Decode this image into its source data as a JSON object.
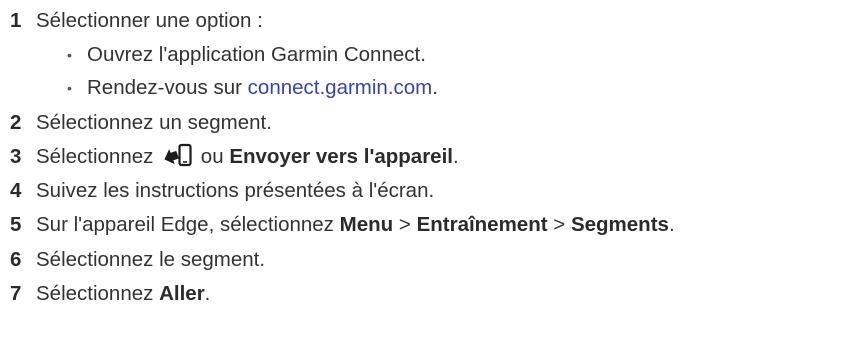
{
  "steps": [
    {
      "num": "1",
      "text": "Sélectionner une option :"
    },
    {
      "num": "2",
      "text": "Sélectionnez un segment."
    },
    {
      "num": "3",
      "pre": "Sélectionnez",
      "mid": "ou",
      "bold": "Envoyer vers l'appareil",
      "post": "."
    },
    {
      "num": "4",
      "text": "Suivez les instructions présentées à l'écran."
    },
    {
      "num": "5",
      "pre": "Sur l'appareil Edge, sélectionnez",
      "b1": "Menu",
      "sep1": ">",
      "b2": "Entraînement",
      "sep2": ">",
      "b3": "Segments",
      "post": "."
    },
    {
      "num": "6",
      "text": "Sélectionnez le segment."
    },
    {
      "num": "7",
      "pre": "Sélectionnez",
      "bold": "Aller",
      "post": "."
    }
  ],
  "options": [
    {
      "bullet": "•",
      "text": "Ouvrez l'application Garmin Connect."
    },
    {
      "bullet": "•",
      "pre": "Rendez-vous sur",
      "link": "connect.garmin.com",
      "post": "."
    }
  ],
  "icons": {
    "send_icon": "send-to-device-icon"
  },
  "colors": {
    "text": "#333333",
    "link": "#3b44a5"
  }
}
